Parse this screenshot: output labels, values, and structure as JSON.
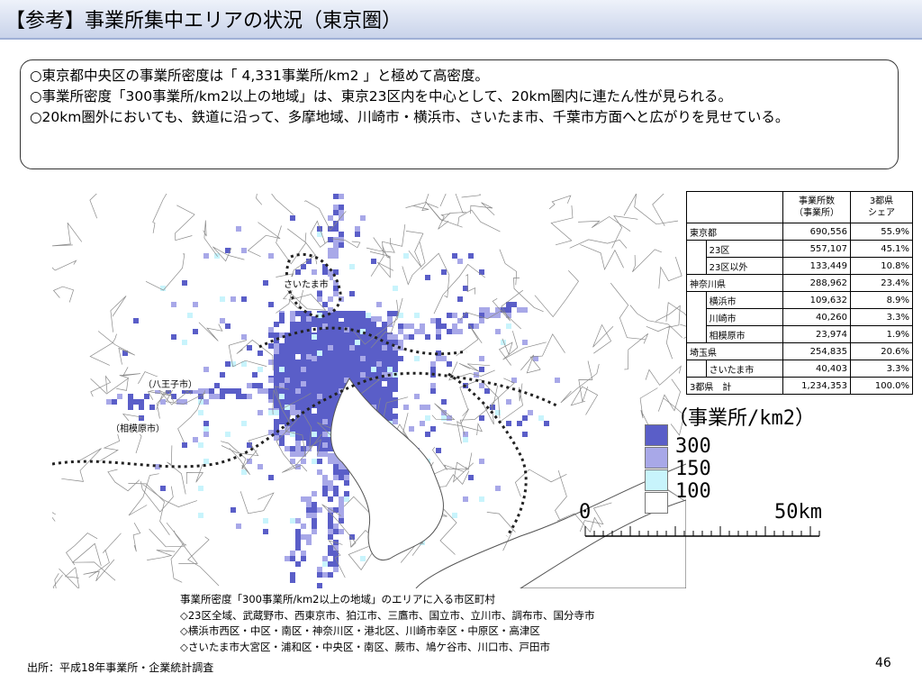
{
  "slide": {
    "title": "【参考】事業所集中エリアの状況（東京圏）",
    "page_number": "46",
    "source": "出所：平成18年事業所・企業統計調査"
  },
  "summary": [
    "○東京都中央区の事業所密度は「 4,331事業所/km2 」と極めて高密度。",
    "○事業所密度「300事業所/km2以上の地域」は、東京23区内を中心として、20km圏内に連たん性が見られる。",
    "○20km圏外においても、鉄道に沿って、多摩地域、川崎市・横浜市、さいたま市、千葉市方面へと広がりを見せている。"
  ],
  "map": {
    "labels": {
      "saitama": "さいたま市",
      "hachioji": "（八王子市）",
      "sagamihara": "（相模原市）"
    },
    "colors": {
      "d300": "#5a5ec8",
      "d150": "#a8a8e8",
      "d100": "#c8f4fc",
      "d0": "#ffffff",
      "boundary": "#666666"
    }
  },
  "table": {
    "headers": [
      "",
      "事業所数\n（事業所）",
      "3都県\nシェア"
    ],
    "rows": [
      {
        "label": "東京都",
        "level": 0,
        "count": "690,556",
        "share": "55.9%"
      },
      {
        "label": "23区",
        "level": 1,
        "count": "557,107",
        "share": "45.1%"
      },
      {
        "label": "23区以外",
        "level": 1,
        "count": "133,449",
        "share": "10.8%"
      },
      {
        "label": "神奈川県",
        "level": 0,
        "count": "288,962",
        "share": "23.4%"
      },
      {
        "label": "横浜市",
        "level": 1,
        "count": "109,632",
        "share": "8.9%"
      },
      {
        "label": "川崎市",
        "level": 1,
        "count": "40,260",
        "share": "3.3%"
      },
      {
        "label": "相模原市",
        "level": 1,
        "count": "23,974",
        "share": "1.9%"
      },
      {
        "label": "埼玉県",
        "level": 0,
        "count": "254,835",
        "share": "20.6%"
      },
      {
        "label": "さいたま市",
        "level": 1,
        "count": "40,403",
        "share": "3.3%"
      },
      {
        "label": "3都県　計",
        "level": 0,
        "count": "1,234,353",
        "share": "100.0%"
      }
    ]
  },
  "legend": {
    "title": "（事業所/km2）",
    "items": [
      {
        "label": "300",
        "color": "#5a5ec8"
      },
      {
        "label": "150",
        "color": "#a8a8e8"
      },
      {
        "label": "100",
        "color": "#c8f4fc"
      },
      {
        "label": "",
        "color": "#ffffff"
      }
    ],
    "scale_start": "0",
    "scale_end": "50km"
  },
  "notes": [
    "事業所密度「300事業所/km2以上の地域」のエリアに入る市区町村",
    "◇23区全域、武蔵野市、西東京市、狛江市、三鷹市、国立市、立川市、調布市、国分寺市",
    "◇横浜市西区・中区・南区・神奈川区・港北区、川崎市幸区・中原区・高津区",
    "◇さいたま市大宮区・浦和区・中央区・南区、蕨市、鳩ケ谷市、川口市、戸田市"
  ]
}
